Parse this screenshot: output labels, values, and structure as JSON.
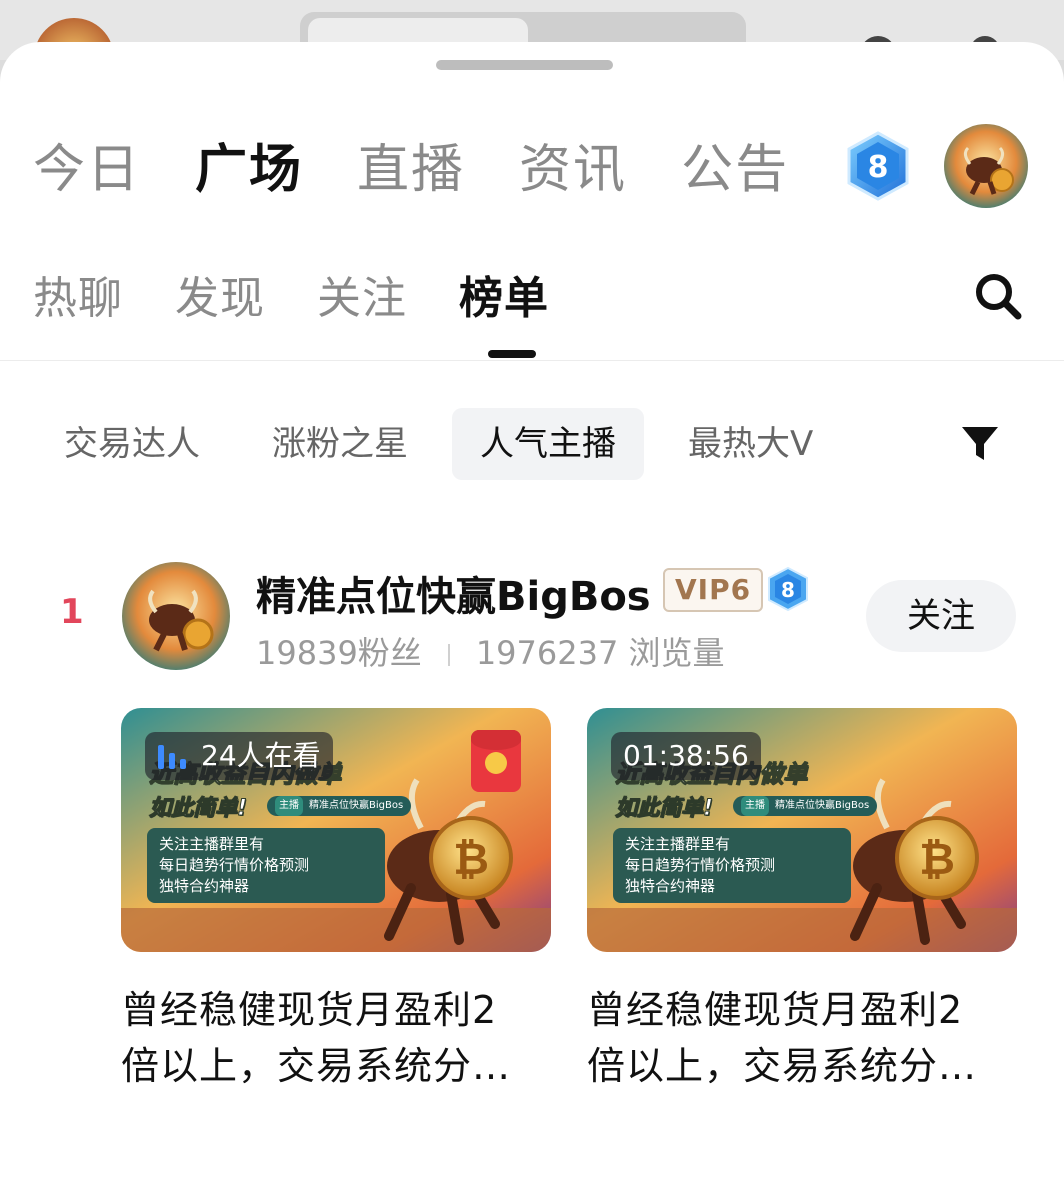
{
  "top_nav": {
    "tabs": [
      "今日",
      "广场",
      "直播",
      "资讯",
      "公告"
    ],
    "active_index": 1,
    "level_badge": "8"
  },
  "sub_nav": {
    "tabs": [
      "热聊",
      "发现",
      "关注",
      "榜单"
    ],
    "active_index": 3
  },
  "chips": {
    "items": [
      "交易达人",
      "涨粉之星",
      "人气主播",
      "最热大V"
    ],
    "active_index": 2
  },
  "ranking": [
    {
      "rank": "1",
      "name": "精准点位快赢BigBos",
      "vip": "VIP6",
      "level": "8",
      "followers": "19839粉丝",
      "views": "1976237 浏览量",
      "follow_label": "关注",
      "cards": [
        {
          "overlay": "24人在看",
          "overlay_type": "live",
          "thumb_headline1": "近高收益目内做单",
          "thumb_headline2": "如此简单!",
          "thumb_host_tag": "主播",
          "thumb_host_name": "精准点位快赢BigBos",
          "thumb_lines": [
            "关注主播群里有",
            "每日趋势行情价格预测",
            "独特合约神器"
          ],
          "title_line1": "曾经稳健现货月盈利2",
          "title_line2": "倍以上，交易系统分…"
        },
        {
          "overlay": "01:38:56",
          "overlay_type": "duration",
          "thumb_headline1": "近高收益目内做单",
          "thumb_headline2": "如此简单!",
          "thumb_host_tag": "主播",
          "thumb_host_name": "精准点位快赢BigBos",
          "thumb_lines": [
            "关注主播群里有",
            "每日趋势行情价格预测",
            "独特合约神器"
          ],
          "title_line1": "曾经稳健现货月盈利2",
          "title_line2": "倍以上，交易系统分…"
        }
      ]
    }
  ],
  "colors": {
    "rank": "#e2465b",
    "level_badge": "#2f8fe8",
    "red_envelope": "#e9373e"
  }
}
